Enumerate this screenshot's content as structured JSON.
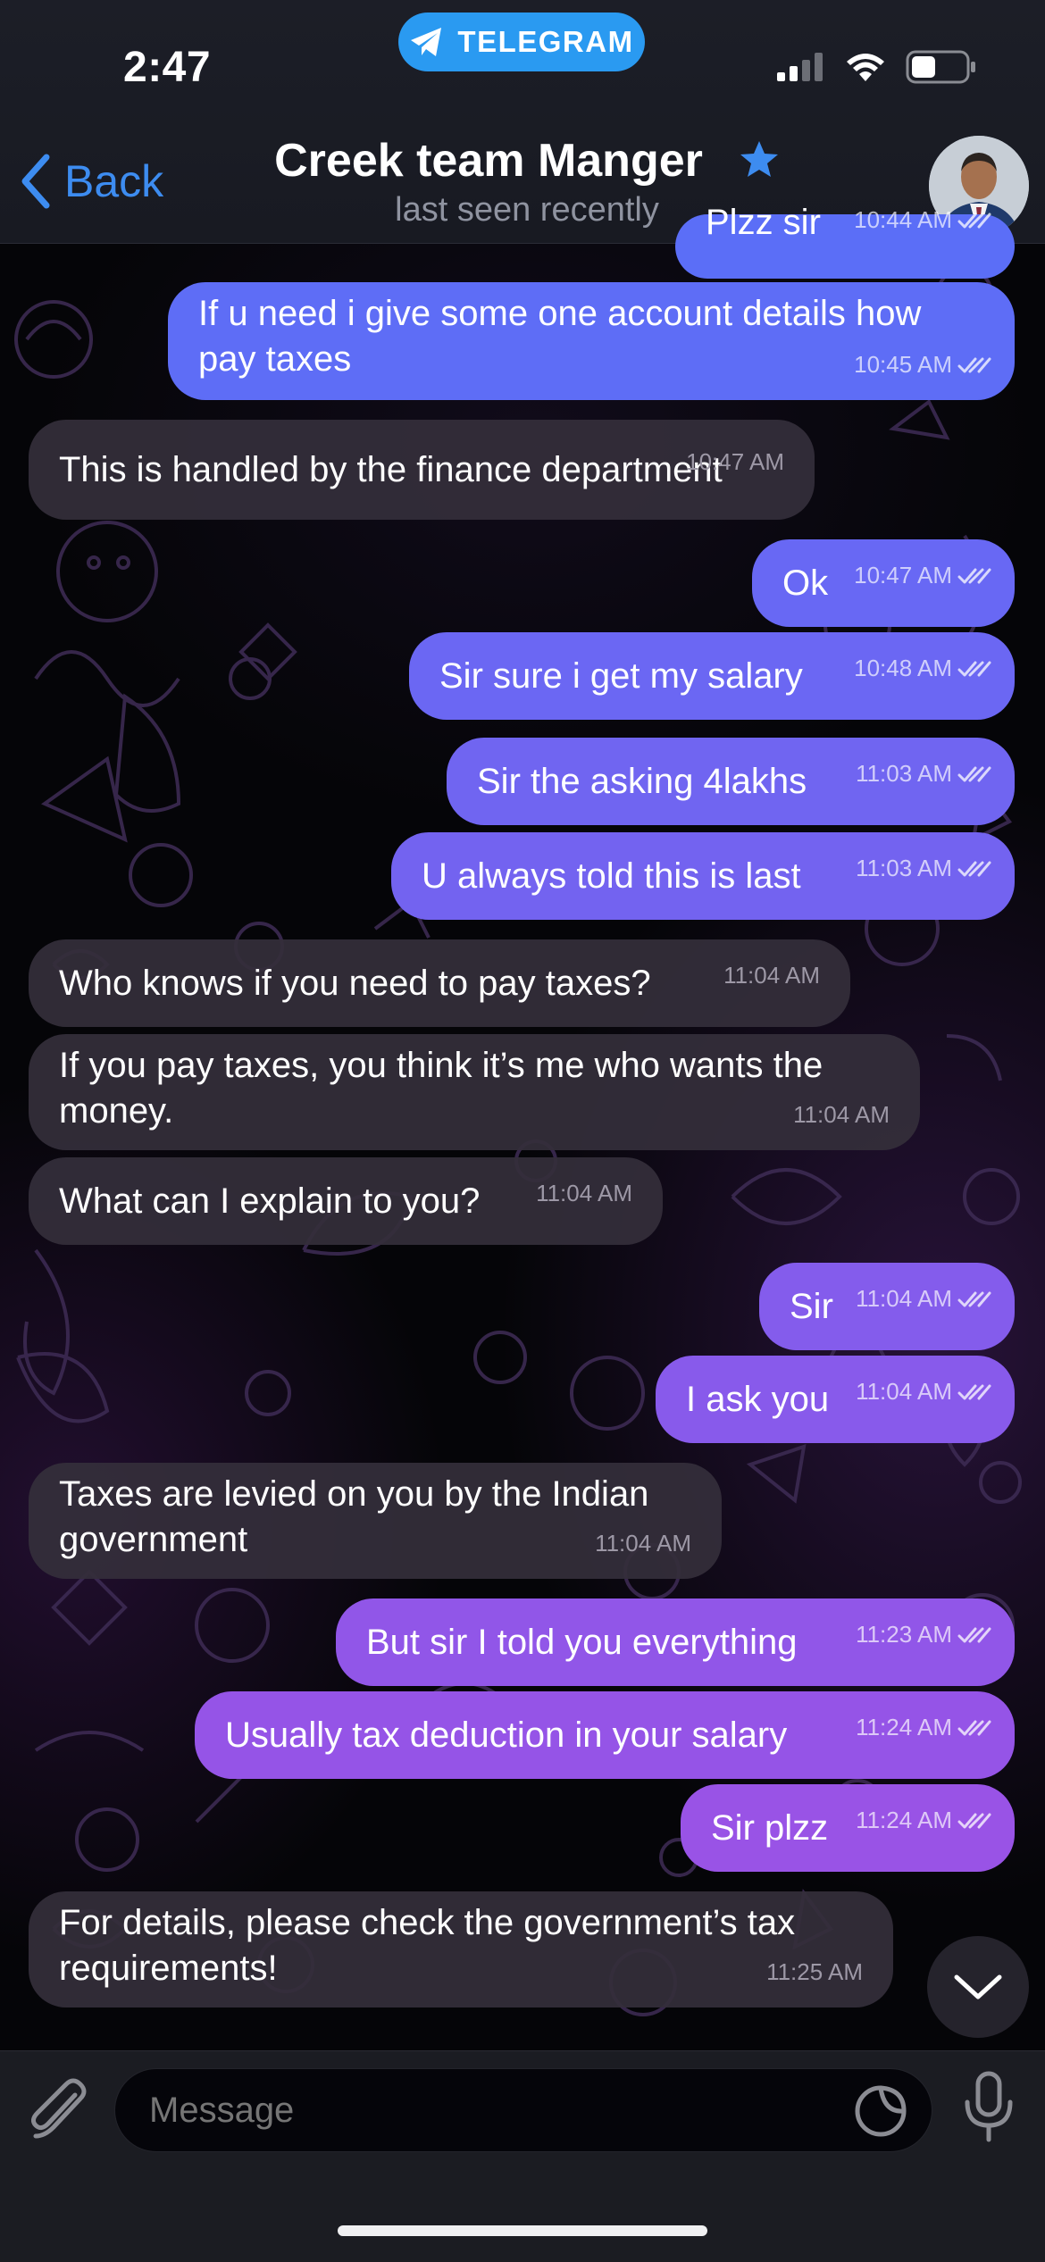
{
  "status_bar": {
    "time": "2:47",
    "app_pill": "TELEGRAM"
  },
  "header": {
    "back_label": "Back",
    "title": "Creek team Manger",
    "subtitle": "last seen recently"
  },
  "colors": {
    "accent": "#3d8cf0",
    "telegram_pill": "#2a9af1",
    "incoming_bubble": "#342e3a",
    "outgoing_bubble_top": "#5b6ef7",
    "outgoing_bubble_bottom": "#9a52e6"
  },
  "messages": [
    {
      "dir": "out",
      "text": "Plzz sir",
      "time": "10:44 AM",
      "partial": true
    },
    {
      "dir": "out",
      "text": "If u need i give some one account details how\npay taxes",
      "time": "10:45 AM"
    },
    {
      "dir": "in",
      "text": "This is handled by the finance department",
      "time": "10:47 AM"
    },
    {
      "dir": "out",
      "text": "Ok",
      "time": "10:47 AM"
    },
    {
      "dir": "out",
      "text": "Sir sure i get my salary",
      "time": "10:48 AM"
    },
    {
      "dir": "out",
      "text": "Sir the asking 4lakhs",
      "time": "11:03 AM"
    },
    {
      "dir": "out",
      "text": "U always told this is last",
      "time": "11:03 AM"
    },
    {
      "dir": "in",
      "text": "Who knows if you need to pay taxes?",
      "time": "11:04 AM"
    },
    {
      "dir": "in",
      "text": "If you pay taxes, you think it’s me who wants the\nmoney.",
      "time": "11:04 AM"
    },
    {
      "dir": "in",
      "text": "What can I explain to you?",
      "time": "11:04 AM"
    },
    {
      "dir": "out",
      "text": "Sir",
      "time": "11:04 AM"
    },
    {
      "dir": "out",
      "text": "I ask you",
      "time": "11:04 AM"
    },
    {
      "dir": "in",
      "text": "Taxes are levied on you by the Indian\ngovernment",
      "time": "11:04 AM"
    },
    {
      "dir": "out",
      "text": "But sir I told you everything",
      "time": "11:23 AM"
    },
    {
      "dir": "out",
      "text": "Usually tax deduction in your salary",
      "time": "11:24 AM"
    },
    {
      "dir": "out",
      "text": "Sir plzz",
      "time": "11:24 AM"
    },
    {
      "dir": "in",
      "text": "For details, please check the government’s tax\nrequirements!",
      "time": "11:25 AM"
    }
  ],
  "input": {
    "placeholder": "Message"
  },
  "icons": {
    "attach": "paperclip-icon",
    "sticker": "sticker-icon",
    "voice": "microphone-icon",
    "scroll": "chevron-down-icon",
    "verified": "star-icon"
  }
}
